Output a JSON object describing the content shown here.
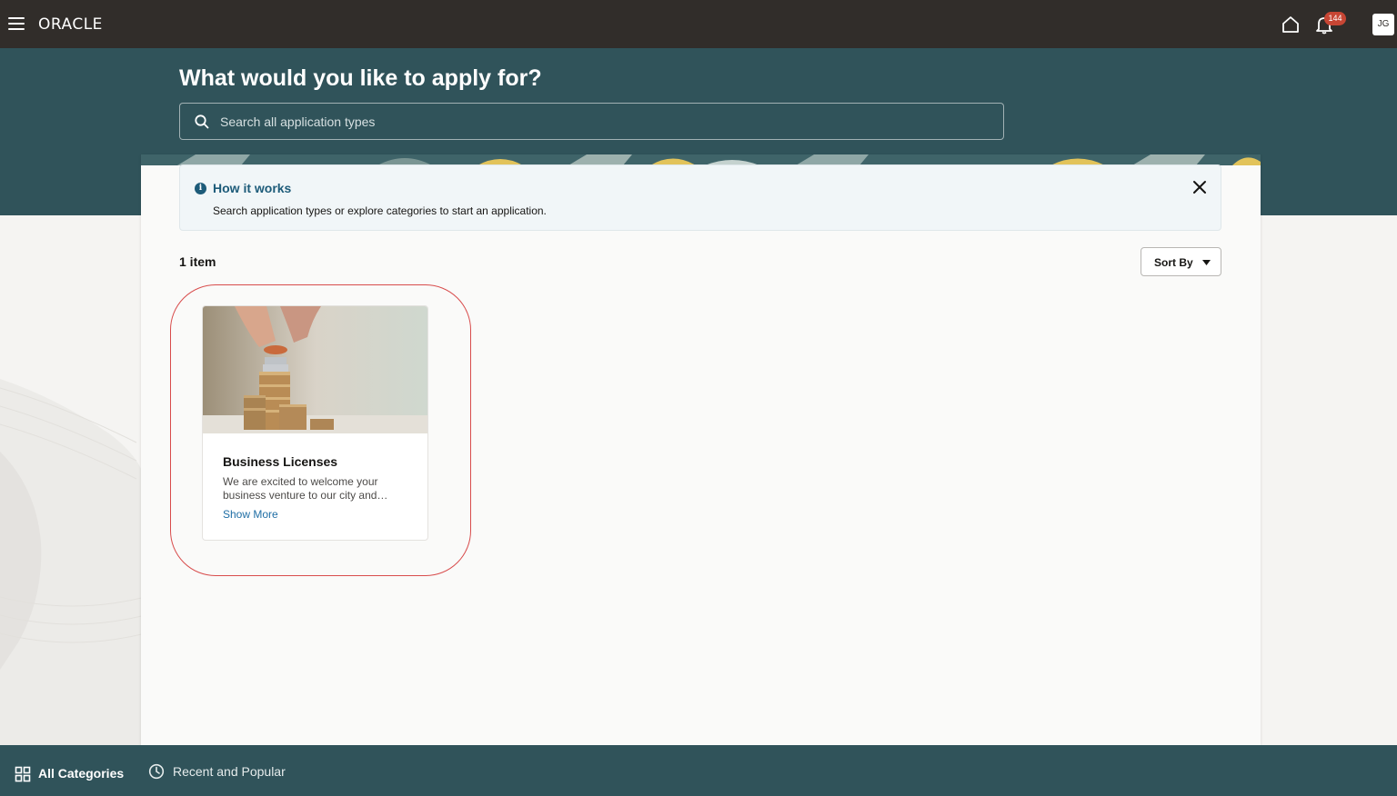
{
  "topbar": {
    "logo": "ORACLE",
    "notification_count": "144",
    "avatar_initials": "JG"
  },
  "hero": {
    "title": "What would you like to apply for?",
    "search_placeholder": "Search all application types"
  },
  "info": {
    "title": "How it works",
    "text": "Search application types or explore categories to start an application."
  },
  "results": {
    "count_label": "1 item",
    "sort_label": "Sort By"
  },
  "cards": [
    {
      "title": "Business Licenses",
      "description": "We are excited to welcome your business venture to our city and…",
      "link": "Show More"
    }
  ],
  "bottom_tabs": {
    "all_categories": "All Categories",
    "recent_popular": "Recent and Popular"
  },
  "colors": {
    "topbar": "#312d2a",
    "hero": "#30535a",
    "badge": "#c74634",
    "link": "#1f6ea5",
    "highlight": "#d84c4c"
  }
}
